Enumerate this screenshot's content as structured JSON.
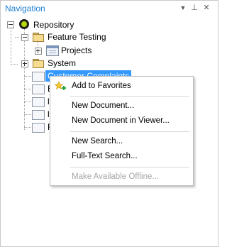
{
  "panel": {
    "title": "Navigation",
    "buttons": {
      "dropdown": "▼",
      "pin": "⊥",
      "close": "✕"
    }
  },
  "tree": {
    "repository": "Repository",
    "feature_testing": "Feature Testing",
    "projects": "Projects",
    "system": "System",
    "customer_complaints": "Customer Complaints",
    "partial_1": "E",
    "partial_2": "l",
    "partial_3": "l",
    "partial_4": "F"
  },
  "context_menu": {
    "add_to_favorites": "Add to Favorites",
    "new_document": "New Document...",
    "new_document_in_viewer": "New Document in Viewer...",
    "new_search": "New Search...",
    "full_text_search": "Full-Text Search...",
    "make_available_offline": "Make Available Offline..."
  },
  "colors": {
    "title": "#1e7fd2",
    "selection": "#3399ff",
    "disabled_text": "#a6a6a6"
  }
}
